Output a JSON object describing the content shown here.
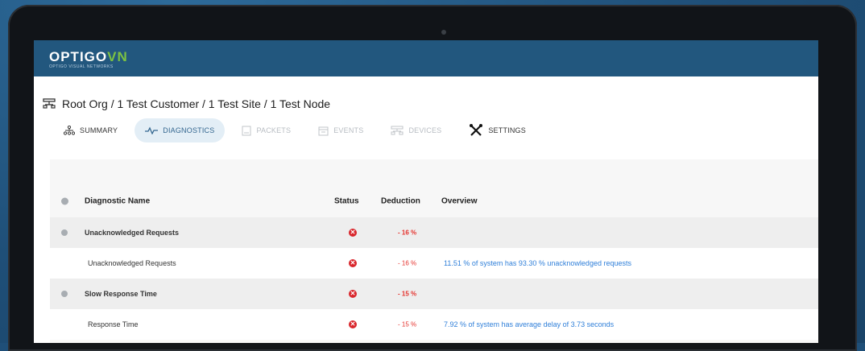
{
  "app": {
    "logo_main": "OPTIGO",
    "logo_accent": "VN",
    "logo_subtitle": "OPTIGO VISUAL NETWORKS"
  },
  "breadcrumb": "Root Org / 1 Test Customer / 1 Test Site / 1 Test Node",
  "tabs": [
    {
      "label": "SUMMARY",
      "icon": "hierarchy-icon",
      "state": "normal"
    },
    {
      "label": "DIAGNOSTICS",
      "icon": "pulse-icon",
      "state": "active"
    },
    {
      "label": "PACKETS",
      "icon": "document-icon",
      "state": "disabled"
    },
    {
      "label": "EVENTS",
      "icon": "calendar-icon",
      "state": "disabled"
    },
    {
      "label": "DEVICES",
      "icon": "devices-icon",
      "state": "disabled"
    },
    {
      "label": "SETTINGS",
      "icon": "tools-icon",
      "state": "normal"
    }
  ],
  "table": {
    "headers": {
      "name": "Diagnostic Name",
      "status": "Status",
      "deduction": "Deduction",
      "overview": "Overview"
    },
    "rows": [
      {
        "type": "group",
        "name": "Unacknowledged Requests",
        "status": "error",
        "deduction": "- 16 %",
        "overview": ""
      },
      {
        "type": "child",
        "name": "Unacknowledged Requests",
        "status": "error",
        "deduction": "- 16 %",
        "overview": "11.51 % of system has 93.30 % unacknowledged requests"
      },
      {
        "type": "group",
        "name": "Slow Response Time",
        "status": "error",
        "deduction": "- 15 %",
        "overview": ""
      },
      {
        "type": "child",
        "name": "Response Time",
        "status": "error",
        "deduction": "- 15 %",
        "overview": "7.92 % of system has average delay of 3.73 seconds"
      }
    ]
  },
  "colors": {
    "brand_blue": "#22577e",
    "brand_green": "#7cc242",
    "error_red": "#d9262c",
    "link_blue": "#2f7fd9"
  }
}
